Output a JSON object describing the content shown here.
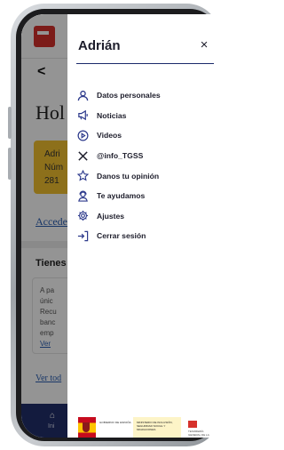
{
  "drawer": {
    "title": "Adrián",
    "close_icon": "×",
    "items": [
      {
        "label": "Datos personales",
        "icon": "user-icon"
      },
      {
        "label": "Noticias",
        "icon": "megaphone-icon"
      },
      {
        "label": "Videos",
        "icon": "play-icon"
      },
      {
        "label": "@info_TGSS",
        "icon": "x-twitter-icon"
      },
      {
        "label": "Danos tu opinión",
        "icon": "star-icon"
      },
      {
        "label": "Te ayudamos",
        "icon": "support-agent-icon"
      },
      {
        "label": "Ajustes",
        "icon": "gear-icon"
      },
      {
        "label": "Cerrar sesión",
        "icon": "logout-icon"
      }
    ]
  },
  "background": {
    "back_glyph": "<",
    "greeting": "Hol",
    "card_lines": [
      "Adri",
      "Núm",
      "281"
    ],
    "link1": "Accede",
    "section": "Tienes",
    "box_lines": [
      "A pa",
      "únic",
      "Recu",
      "banc",
      "emp",
      "Ver"
    ],
    "link2": "Ver tod",
    "tab_label": "Ini"
  },
  "footer": {
    "gov_text": "GOBIERNO DE ESPAÑA",
    "ministry_text": "MINISTERIO DE INCLUSIÓN, SEGURIDAD SOCIAL Y MIGRACIONES",
    "tgss_text": "TESORERÍA GENERAL DE LA SEGURIDAD SOCIAL"
  },
  "colors": {
    "accent": "#2d3a8c",
    "brand_red": "#d6312b",
    "card_yellow": "#f3c130",
    "tabbar": "#22306b"
  }
}
